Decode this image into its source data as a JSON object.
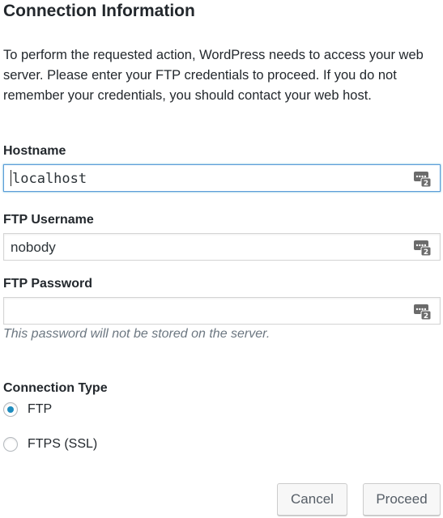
{
  "heading": "Connection Information",
  "description": "To perform the requested action, WordPress needs to access your web server. Please enter your FTP credentials to proceed. If you do not remember your credentials, you should contact your web host.",
  "fields": {
    "hostname": {
      "label": "Hostname",
      "value": "localhost"
    },
    "username": {
      "label": "FTP Username",
      "value": "nobody"
    },
    "password": {
      "label": "FTP Password",
      "value": ""
    }
  },
  "password_hint": "This password will not be stored on the server.",
  "connection_type": {
    "label": "Connection Type",
    "options": [
      {
        "label": "FTP",
        "checked": true
      },
      {
        "label": "FTPS (SSL)",
        "checked": false
      }
    ]
  },
  "buttons": {
    "cancel": "Cancel",
    "proceed": "Proceed"
  },
  "icons": {
    "keychain": "keychain-autofill-icon"
  },
  "colors": {
    "focus_border": "#5b9dd9",
    "radio_checked": "#1e8cbe"
  }
}
